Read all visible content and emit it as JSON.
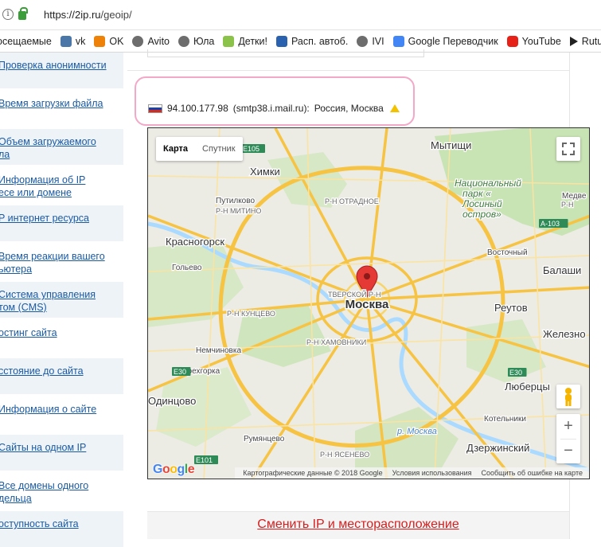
{
  "browser": {
    "url_host": "https://2ip.ru",
    "url_path": "/geoip/"
  },
  "bookmarks": [
    {
      "label": "осещаемые",
      "icon": "none"
    },
    {
      "label": "vk",
      "icon": "vk-icon"
    },
    {
      "label": "OK",
      "icon": "odnoklassniki-icon"
    },
    {
      "label": "Avito",
      "icon": "globe-icon"
    },
    {
      "label": "Юла",
      "icon": "globe-icon"
    },
    {
      "label": "Детки!",
      "icon": "detki-icon"
    },
    {
      "label": "Расп. автоб.",
      "icon": "bus-icon"
    },
    {
      "label": "IVI",
      "icon": "globe-icon"
    },
    {
      "label": "Google Переводчик",
      "icon": "google-translate-icon"
    },
    {
      "label": "YouTube",
      "icon": "youtube-icon"
    },
    {
      "label": "Rutube",
      "icon": "play-icon"
    }
  ],
  "sidebar": {
    "items": [
      {
        "line1": "Проверка анонимности",
        "line2": ""
      },
      {
        "line1": "Время загрузки файла",
        "line2": ""
      },
      {
        "line1": "Объем загружаемого",
        "line2": "ла"
      },
      {
        "line1": "Информация об IP",
        "line2": "есе или домене"
      },
      {
        "line1": "P интернет ресурса",
        "line2": ""
      },
      {
        "line1": "Время реакции вашего",
        "line2": "ьютера"
      },
      {
        "line1": "Система управления",
        "line2": "том (CMS)"
      },
      {
        "line1": "остинг сайта",
        "line2": ""
      },
      {
        "line1": "сстояние до сайта",
        "line2": ""
      },
      {
        "line1": "Информация о сайте",
        "line2": ""
      },
      {
        "line1": "Сайты на одном IP",
        "line2": ""
      },
      {
        "line1": "Все домены одного",
        "line2": "дельца"
      },
      {
        "line1": "оступность сайта",
        "line2": ""
      }
    ]
  },
  "ip_info": {
    "ip": "94.100.177.98",
    "host": "(smtp38.i.mail.ru):",
    "location": "Россия, Москва"
  },
  "map": {
    "tabs": {
      "map": "Карта",
      "satellite": "Спутник"
    },
    "center_label": "Москва",
    "places": [
      {
        "name": "Мытищи",
        "cls": "city"
      },
      {
        "name": "Химки",
        "cls": "city"
      },
      {
        "name": "Путилково",
        "cls": "small"
      },
      {
        "name": "Р-Н ОТРАДНОЕ",
        "cls": "district"
      },
      {
        "name": "Р-Н МИТИНО",
        "cls": "district"
      },
      {
        "name": "Красногорск",
        "cls": "city"
      },
      {
        "name": "Гольево",
        "cls": "small"
      },
      {
        "name": "ТВЕРСКОЙ Р-Н",
        "cls": "district"
      },
      {
        "name": "Р-Н КУНЦЕВО",
        "cls": "district"
      },
      {
        "name": "Р-Н ХАМОВНИКИ",
        "cls": "district"
      },
      {
        "name": "Немчиновка",
        "cls": "small"
      },
      {
        "name": "Трехгорка",
        "cls": "small"
      },
      {
        "name": "Одинцово",
        "cls": "city"
      },
      {
        "name": "Румянцево",
        "cls": "small"
      },
      {
        "name": "Р-Н ЯСЕНЕВО",
        "cls": "district"
      },
      {
        "name": "Национальный",
        "cls": "park"
      },
      {
        "name": "парк «",
        "cls": "park"
      },
      {
        "name": "Лосиный",
        "cls": "park"
      },
      {
        "name": "остров»",
        "cls": "park"
      },
      {
        "name": "Восточный",
        "cls": "small"
      },
      {
        "name": "Балаши",
        "cls": "city"
      },
      {
        "name": "Реутов",
        "cls": "city"
      },
      {
        "name": "Железно",
        "cls": "city"
      },
      {
        "name": "Люберцы",
        "cls": "city"
      },
      {
        "name": "Котельники",
        "cls": "small"
      },
      {
        "name": "Дзержинский",
        "cls": "city"
      },
      {
        "name": "р. Москва",
        "cls": "river"
      },
      {
        "name": "Медве",
        "cls": "small"
      },
      {
        "name": "Р-Н",
        "cls": "district"
      }
    ],
    "road_labels": [
      "E105",
      "A-103",
      "E30",
      "E30",
      "E101"
    ],
    "attribution": {
      "data": "Картографические данные © 2018 Google",
      "terms": "Условия использования",
      "report": "Сообщить об ошибке на карте"
    },
    "google": [
      "G",
      "o",
      "o",
      "g",
      "l",
      "e"
    ],
    "zoom_in": "+",
    "zoom_out": "−"
  },
  "change_link": "Сменить IP и месторасположение",
  "colors": {
    "link": "#1a5aa5",
    "change_link": "#d51f1f",
    "annotation": "#f3a8c8",
    "pin": "#e53935"
  }
}
